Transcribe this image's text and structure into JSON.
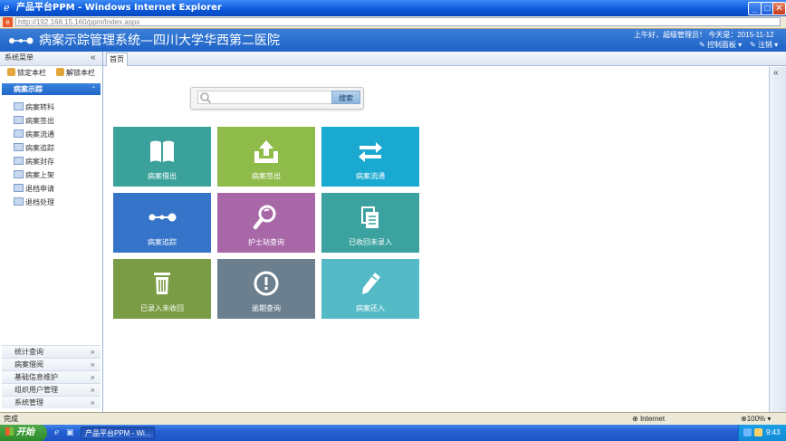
{
  "window": {
    "title": "产品平台PPM - Windows Internet Explorer",
    "address": "http://192.168.15.160/ppm/Index.aspx"
  },
  "header": {
    "app_title": "病案示踪管理系统—四川大学华西第二医院",
    "welcome": "上午好，超级管理员！ 今天是：2015-11-12",
    "control_panel": "控制面板",
    "logout": "注销"
  },
  "sidebar": {
    "title": "系统菜单",
    "collapse_glyph": "«",
    "lock_label": "锁定本栏",
    "unlock_label": "解锁本栏",
    "active_section": "病案示踪",
    "items": [
      {
        "label": "病案转科"
      },
      {
        "label": "病案签出"
      },
      {
        "label": "病案流通"
      },
      {
        "label": "病案追踪"
      },
      {
        "label": "病案封存"
      },
      {
        "label": "病案上架"
      },
      {
        "label": "退档申请"
      },
      {
        "label": "退档处理"
      }
    ],
    "accordion": [
      {
        "label": "统计查询"
      },
      {
        "label": "病案借阅"
      },
      {
        "label": "基础信息维护"
      },
      {
        "label": "组织用户管理"
      },
      {
        "label": "系统管理"
      }
    ]
  },
  "tabs": [
    {
      "label": "首页"
    }
  ],
  "right_collapse_glyph": "«",
  "search": {
    "placeholder": "",
    "button_label": "搜索"
  },
  "tiles": [
    {
      "label": "病案借出",
      "color": "#3aa19b",
      "icon": "book-icon"
    },
    {
      "label": "病案签出",
      "color": "#8fbb4b",
      "icon": "upload-icon"
    },
    {
      "label": "病案流通",
      "color": "#1aa9d1",
      "icon": "swap-icon"
    },
    {
      "label": "病案追踪",
      "color": "#3574c9",
      "icon": "track-icon"
    },
    {
      "label": "护士站查询",
      "color": "#a868a8",
      "icon": "magnifier-icon"
    },
    {
      "label": "已收回未录入",
      "color": "#3ba29f",
      "icon": "documents-icon"
    },
    {
      "label": "已录入未收回",
      "color": "#7a9c44",
      "icon": "trash-icon"
    },
    {
      "label": "逾期查询",
      "color": "#6b7f8f",
      "icon": "alert-icon"
    },
    {
      "label": "病案还入",
      "color": "#54bac6",
      "icon": "pencil-icon"
    }
  ],
  "statusbar": {
    "text": "完成",
    "zone": "Internet",
    "zoom": "100%"
  },
  "taskbar": {
    "start": "开始",
    "task": "产品平台PPM - Wi...",
    "clock": "9:43"
  }
}
